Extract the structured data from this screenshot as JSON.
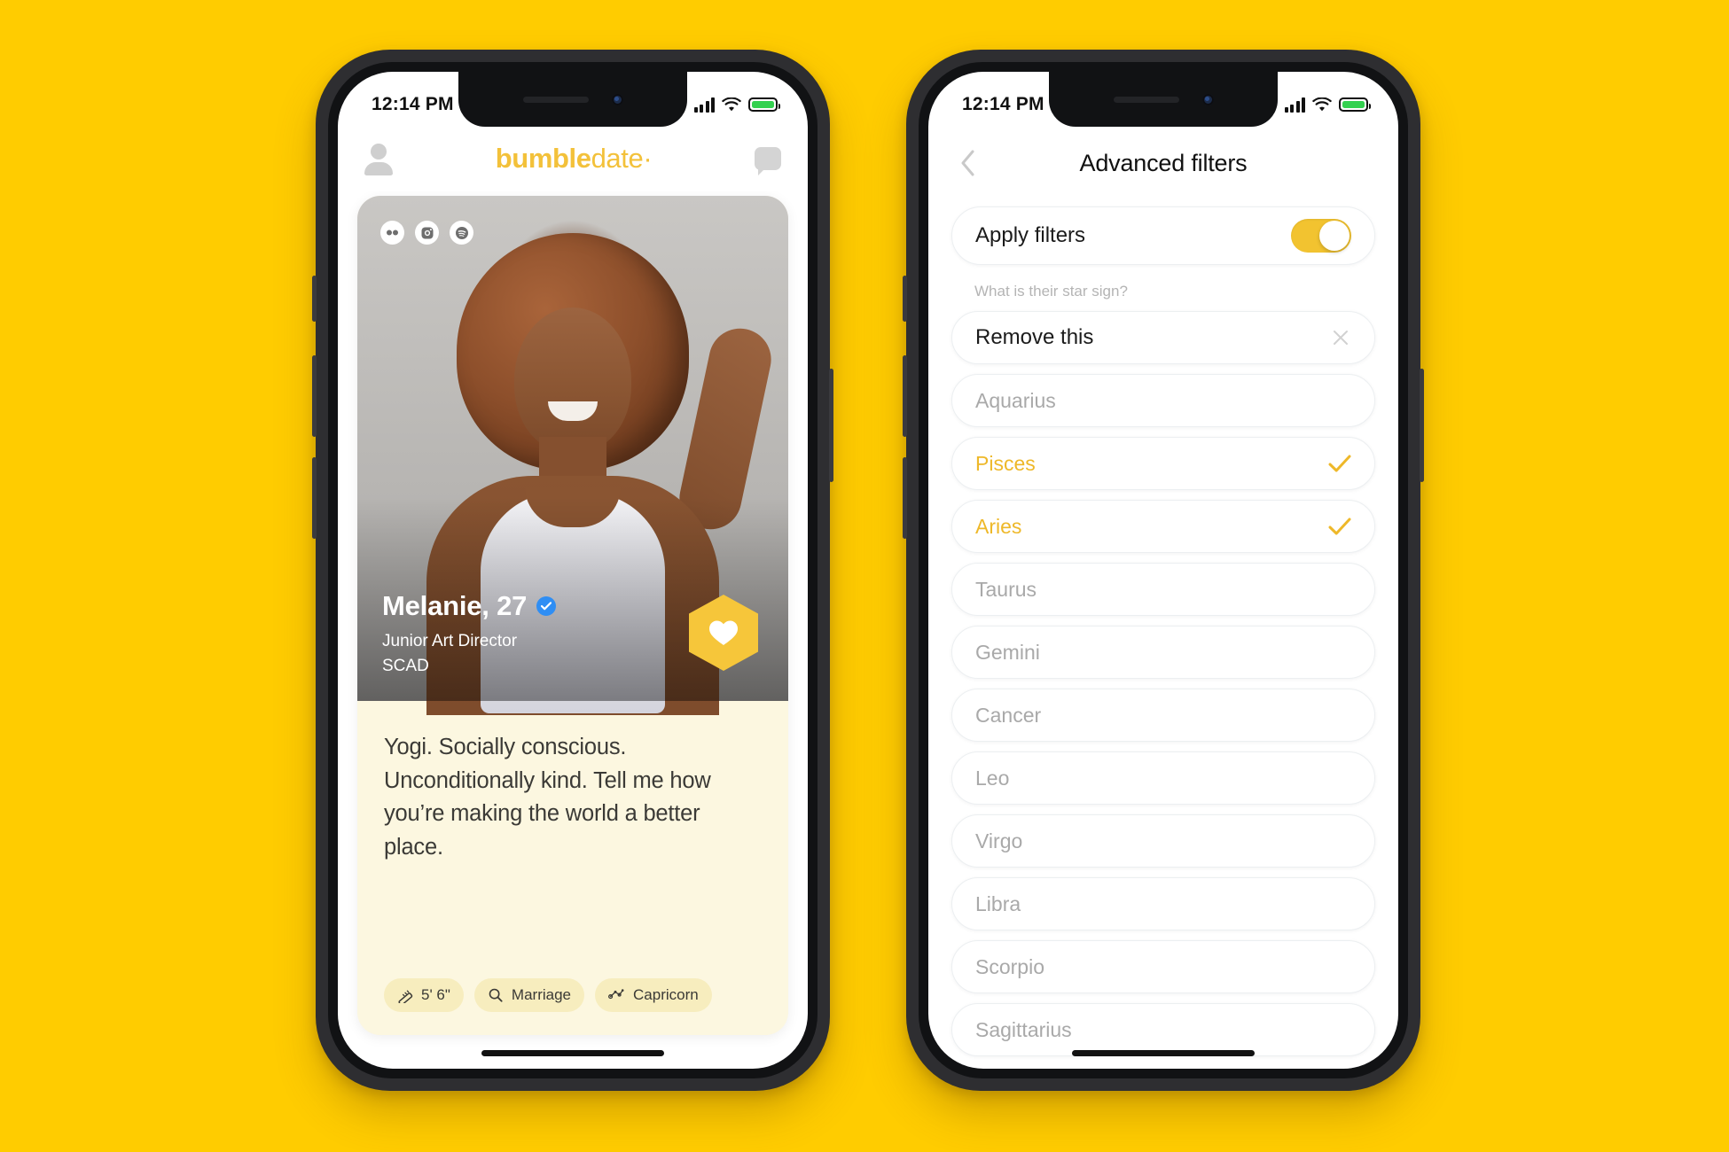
{
  "theme": {
    "background": "#FFCC00",
    "brand_yellow": "#F3C13A",
    "toggle_on": "#F2C330",
    "selected_text": "#EEB829",
    "cream": "#FCF7E0",
    "chip_bg": "#F7EDBE",
    "verified_blue": "#2F8EF4"
  },
  "left_phone": {
    "status": {
      "time": "12:14 PM",
      "signal": "cellular-bars",
      "wifi": "wifi-icon",
      "battery": "battery-full"
    },
    "header": {
      "profile_icon": "profile-icon",
      "brand_part1": "bumble",
      "brand_part2": "date·",
      "chat_icon": "chat-icon"
    },
    "card": {
      "photo_badges": [
        "bumble-eyes-icon",
        "instagram-icon",
        "spotify-icon"
      ],
      "name": "Melanie, 27",
      "verified": "verified-badge",
      "job_title": "Junior Art Director",
      "school": "SCAD",
      "like_button": "heart-icon",
      "bio": "Yogi. Socially conscious. Unconditionally kind. Tell me how you’re making the world a better place.",
      "chips": [
        {
          "icon": "ruler-icon",
          "label": "5' 6\""
        },
        {
          "icon": "magnifier-icon",
          "label": "Marriage"
        },
        {
          "icon": "constellation-icon",
          "label": "Capricorn"
        }
      ]
    }
  },
  "right_phone": {
    "status": {
      "time": "12:14 PM",
      "signal": "cellular-bars",
      "wifi": "wifi-icon",
      "battery": "battery-full"
    },
    "header": {
      "back_icon": "chevron-left-icon",
      "title": "Advanced filters"
    },
    "apply_filters": {
      "label": "Apply filters",
      "enabled": true
    },
    "section_label": "What is their star sign?",
    "remove_row": {
      "label": "Remove this",
      "clear_icon": "close-icon"
    },
    "star_signs": [
      {
        "label": "Aquarius",
        "selected": false
      },
      {
        "label": "Pisces",
        "selected": true
      },
      {
        "label": "Aries",
        "selected": true
      },
      {
        "label": "Taurus",
        "selected": false
      },
      {
        "label": "Gemini",
        "selected": false
      },
      {
        "label": "Cancer",
        "selected": false
      },
      {
        "label": "Leo",
        "selected": false
      },
      {
        "label": "Virgo",
        "selected": false
      },
      {
        "label": "Libra",
        "selected": false
      },
      {
        "label": "Scorpio",
        "selected": false
      },
      {
        "label": "Sagittarius",
        "selected": false
      }
    ]
  }
}
